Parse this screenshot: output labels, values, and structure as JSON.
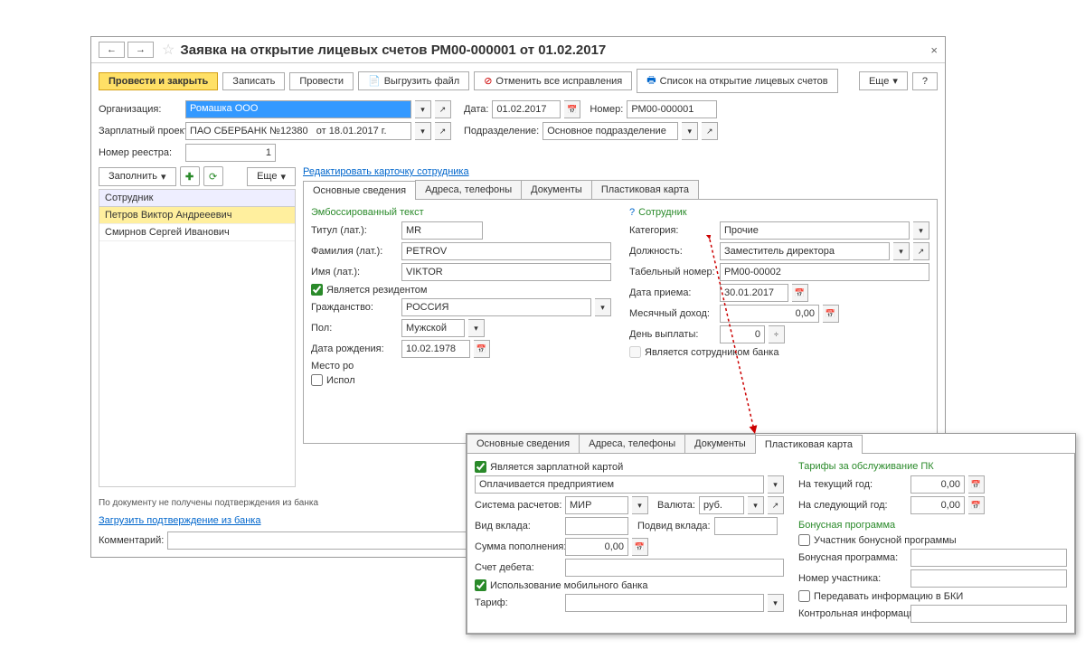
{
  "title": "Заявка на открытие лицевых счетов РМ00-000001 от 01.02.2017",
  "toolbar": {
    "post_close": "Провести и закрыть",
    "write": "Записать",
    "post": "Провести",
    "export": "Выгрузить файл",
    "cancel_fix": "Отменить все исправления",
    "list_open": "Список на открытие лицевых счетов",
    "more": "Еще",
    "help": "?"
  },
  "header": {
    "org_lbl": "Организация:",
    "org_val": "Ромашка ООО",
    "date_lbl": "Дата:",
    "date_val": "01.02.2017",
    "num_lbl": "Номер:",
    "num_val": "РМ00-000001",
    "proj_lbl": "Зарплатный проект:",
    "proj_val": "ПАО СБЕРБАНК №12380   от 18.01.2017 г.",
    "dept_lbl": "Подразделение:",
    "dept_val": "Основное подразделение",
    "reg_lbl": "Номер реестра:",
    "reg_val": "1"
  },
  "emp": {
    "fill": "Заполнить",
    "more": "Еще",
    "header": "Сотрудник",
    "items": [
      "Петров Виктор Андрееевич",
      "Смирнов Сергей Иванович"
    ]
  },
  "link_edit": "Редактировать карточку сотрудника",
  "tabs1": [
    "Основные сведения",
    "Адреса, телефоны",
    "Документы",
    "Пластиковая карта"
  ],
  "emboss": {
    "title": "Эмбоссированный текст",
    "titul_lbl": "Титул (лат.):",
    "titul": "MR",
    "fam_lbl": "Фамилия (лат.):",
    "fam": "PETROV",
    "name_lbl": "Имя (лат.):",
    "name": "VIKTOR",
    "resident": "Является резидентом",
    "citiz_lbl": "Гражданство:",
    "citiz": "РОССИЯ",
    "sex_lbl": "Пол:",
    "sex": "Мужской",
    "birth_lbl": "Дата рождения:",
    "birth": "10.02.1978",
    "place_lbl": "Место ро",
    "ispo": "Испол"
  },
  "empdata": {
    "title": "Сотрудник",
    "cat_lbl": "Категория:",
    "cat": "Прочие",
    "pos_lbl": "Должность:",
    "pos": "Заместитель директора",
    "tab_lbl": "Табельный номер:",
    "tab": "РМ00-00002",
    "hire_lbl": "Дата приема:",
    "hire": "30.01.2017",
    "income_lbl": "Месячный доход:",
    "income": "0,00",
    "payday_lbl": "День выплаты:",
    "payday": "0",
    "bank_emp": "Является сотрудником банка"
  },
  "bottom": {
    "notconf": "По документу не получены подтверждения из банка",
    "load": "Загрузить подтверждение из банка",
    "comment_lbl": "Комментарий:"
  },
  "popup": {
    "tabs": [
      "Основные сведения",
      "Адреса, телефоны",
      "Документы",
      "Пластиковая карта"
    ],
    "salary_card": "Является зарплатной картой",
    "paid_by": "Оплачивается предприятием",
    "sys_lbl": "Система расчетов:",
    "sys": "МИР",
    "cur_lbl": "Валюта:",
    "cur": "руб.",
    "dep_lbl": "Вид вклада:",
    "subdep_lbl": "Подвид вклада:",
    "sum_lbl": "Сумма пополнения:",
    "sum": "0,00",
    "debit_lbl": "Счет дебета:",
    "mobile": "Использование мобильного банка",
    "tariff_lbl": "Тариф:",
    "tariffs_h": "Тарифы за обслуживание ПК",
    "cur_year_lbl": "На текущий год:",
    "cur_year": "0,00",
    "next_year_lbl": "На следующий год:",
    "next_year": "0,00",
    "bonus_h": "Бонусная программа",
    "bonus_member": "Участник бонусной программы",
    "bonus_prog_lbl": "Бонусная программа:",
    "part_num_lbl": "Номер участника:",
    "bki": "Передавать информацию в БКИ",
    "ctrl_lbl": "Контрольная информация:"
  }
}
